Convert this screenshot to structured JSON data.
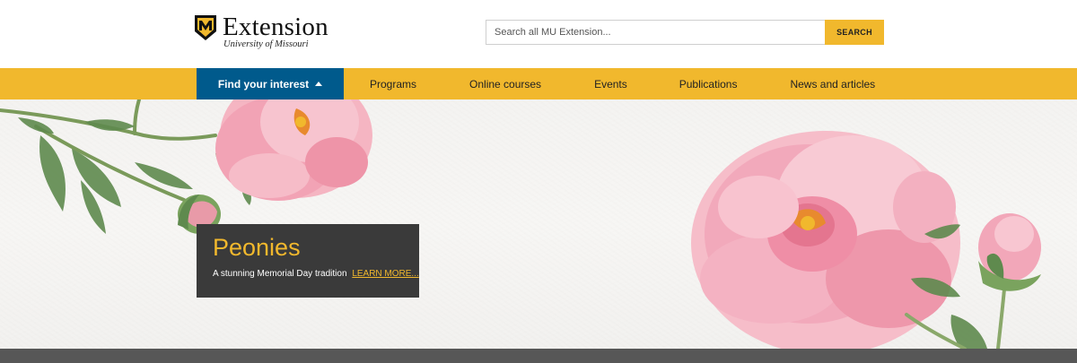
{
  "brand": {
    "name": "Extension",
    "subtitle": "University of Missouri",
    "colors": {
      "gold": "#f1b82d",
      "black": "#111111",
      "blue": "#005a8c"
    }
  },
  "search": {
    "placeholder": "Search all MU Extension...",
    "button_label": "SEARCH"
  },
  "nav": {
    "items": [
      {
        "label": "Find your interest",
        "active": true,
        "icon": "caret-up-icon"
      },
      {
        "label": "Programs"
      },
      {
        "label": "Online courses"
      },
      {
        "label": "Events"
      },
      {
        "label": "Publications"
      },
      {
        "label": "News and articles"
      }
    ]
  },
  "hero": {
    "title": "Peonies",
    "description": "A stunning Memorial Day tradition",
    "link_label": "LEARN MORE..."
  }
}
